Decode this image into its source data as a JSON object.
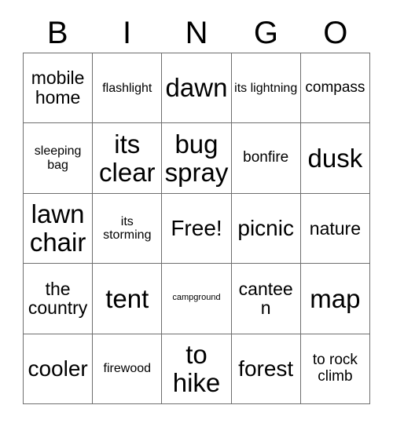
{
  "title": "BINGO Card",
  "header": {
    "letters": [
      "B",
      "I",
      "N",
      "G",
      "O"
    ]
  },
  "colors": {
    "text": "#000000",
    "grid_line": "#6e6e6e",
    "background": "#ffffff"
  },
  "grid": {
    "columns": 5,
    "rows": 5,
    "free_space_index": 12,
    "cells": [
      {
        "text": "mobile home",
        "size": "lg"
      },
      {
        "text": "flashlight",
        "size": "sm"
      },
      {
        "text": "dawn",
        "size": "xxl"
      },
      {
        "text": "its lightning",
        "size": "sm"
      },
      {
        "text": "compass",
        "size": "md"
      },
      {
        "text": "sleeping bag",
        "size": "sm"
      },
      {
        "text": "its clear",
        "size": "xxl"
      },
      {
        "text": "bug spray",
        "size": "xxl"
      },
      {
        "text": "bonfire",
        "size": "md"
      },
      {
        "text": "dusk",
        "size": "xxl"
      },
      {
        "text": "lawn chair",
        "size": "xxl"
      },
      {
        "text": "its storming",
        "size": "sm"
      },
      {
        "text": "Free!",
        "size": "xl"
      },
      {
        "text": "picnic",
        "size": "xl"
      },
      {
        "text": "nature",
        "size": "lg"
      },
      {
        "text": "the country",
        "size": "lg"
      },
      {
        "text": "tent",
        "size": "xxl"
      },
      {
        "text": "campground",
        "size": "xs"
      },
      {
        "text": "canteen",
        "size": "lg"
      },
      {
        "text": "map",
        "size": "xxl"
      },
      {
        "text": "cooler",
        "size": "xl"
      },
      {
        "text": "firewood",
        "size": "sm"
      },
      {
        "text": "to hike",
        "size": "xxl"
      },
      {
        "text": "forest",
        "size": "xl"
      },
      {
        "text": "to rock climb",
        "size": "md"
      }
    ]
  }
}
